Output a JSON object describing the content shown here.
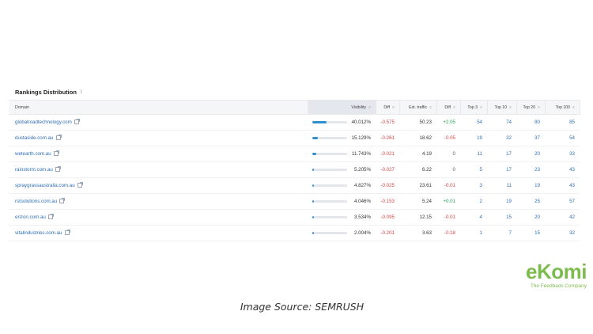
{
  "panel": {
    "title": "Rankings Distribution",
    "info_icon": "info-icon"
  },
  "columns": [
    "Domain",
    "Visibility",
    "Diff",
    "Est. traffic",
    "Diff",
    "Top 3",
    "Top 10",
    "Top 20",
    "Top 100"
  ],
  "rows": [
    {
      "domain": "globalroadtechnology.com",
      "visibility": "40.012%",
      "vis_fraction": 0.4,
      "diff": "-0.575",
      "traffic": "50.23",
      "traffic_diff": "+2.05",
      "top3": "54",
      "top10": "74",
      "top20": "80",
      "top100": "85"
    },
    {
      "domain": "dustaside.com.au",
      "visibility": "15.129%",
      "vis_fraction": 0.151,
      "diff": "-0.261",
      "traffic": "18.62",
      "traffic_diff": "-0.05",
      "top3": "19",
      "top10": "32",
      "top20": "37",
      "top100": "54"
    },
    {
      "domain": "wetearth.com.au",
      "visibility": "11.743%",
      "vis_fraction": 0.117,
      "diff": "-0.021",
      "traffic": "4.19",
      "traffic_diff": "0",
      "top3": "11",
      "top10": "17",
      "top20": "20",
      "top100": "33"
    },
    {
      "domain": "rainstorm.com.au",
      "visibility": "5.205%",
      "vis_fraction": 0.052,
      "diff": "-0.027",
      "traffic": "6.22",
      "traffic_diff": "0",
      "top3": "5",
      "top10": "17",
      "top20": "23",
      "top100": "43"
    },
    {
      "domain": "spraygrassaustralia.com.au",
      "visibility": "4.827%",
      "vis_fraction": 0.048,
      "diff": "-0.025",
      "traffic": "23.61",
      "traffic_diff": "-0.01",
      "top3": "3",
      "top10": "11",
      "top20": "19",
      "top100": "43"
    },
    {
      "domain": "rstsolutions.com.au",
      "visibility": "4.046%",
      "vis_fraction": 0.04,
      "diff": "-0.153",
      "traffic": "5.24",
      "traffic_diff": "+0.01",
      "top3": "2",
      "top10": "19",
      "top20": "25",
      "top100": "57"
    },
    {
      "domain": "erizon.com.au",
      "visibility": "3.534%",
      "vis_fraction": 0.035,
      "diff": "-0.095",
      "traffic": "12.15",
      "traffic_diff": "-0.01",
      "top3": "4",
      "top10": "15",
      "top20": "20",
      "top100": "42"
    },
    {
      "domain": "vitalindustries.com.au",
      "visibility": "2.004%",
      "vis_fraction": 0.02,
      "diff": "-0.201",
      "traffic": "3.63",
      "traffic_diff": "-0.18",
      "top3": "1",
      "top10": "7",
      "top20": "15",
      "top100": "32"
    }
  ],
  "logo": {
    "main": "eKomi",
    "tagline": "The Feedback Company"
  },
  "caption": "Image Source: SEMRUSH",
  "colors": {
    "accent": "#2e8fd1",
    "negative": "#d64545",
    "positive": "#2aa35a",
    "brand": "#7dbb4f"
  }
}
